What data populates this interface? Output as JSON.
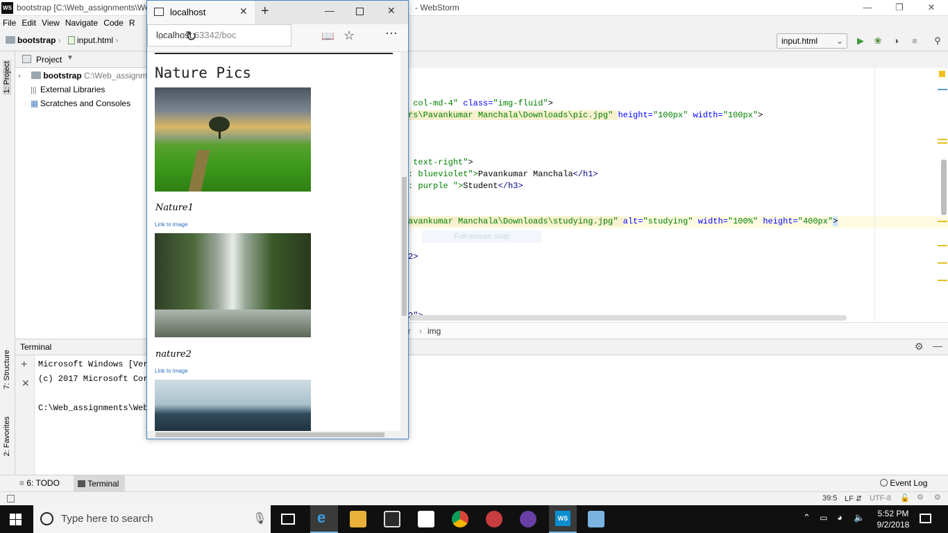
{
  "ide": {
    "title_left": "bootstrap [C:\\Web_assignments\\We",
    "title_right": "- WebStorm",
    "menu": [
      "File",
      "Edit",
      "View",
      "Navigate",
      "Code",
      "R"
    ],
    "breadcrumbs": [
      "bootstrap",
      "input.html"
    ],
    "run_config": "input.html",
    "project": {
      "header": "Project",
      "items": [
        {
          "name": "bootstrap",
          "path": "C:\\Web_assignm"
        },
        {
          "name": "External Libraries"
        },
        {
          "name": "Scratches and Consoles"
        }
      ]
    },
    "left_tools": [
      "1: Project",
      "7: Structure",
      "2: Favorites"
    ],
    "code_lines": [
      {
        "a": "col-md-4\" ",
        "b": "class=",
        "c": "\"img-fluid\"",
        "d": ">"
      },
      {
        "a": "rs\\Pavankumar Manchala\\Downloads\\pic.jpg\" ",
        "b": "height=",
        "c": "\"100px\" ",
        "b2": "width=",
        "c2": "\"100px\"",
        "d": ">"
      },
      {
        "a": "text-right\"",
        "d": ">"
      },
      {
        "a": ": blueviolet\">",
        "t": "Pavankumar Manchala",
        "d": "</h1>"
      },
      {
        "a": ": purple \">",
        "t": "Student",
        "d": "</h3>"
      },
      {
        "a": "avankumar Manchala\\Downloads\\studying.jpg\" ",
        "b": "alt=",
        "c": "\"studying\" ",
        "b2": "width=",
        "c2": "\"100%\" ",
        "b3": "height=",
        "c3": "\"400px\"",
        "d": ">"
      },
      {
        "a": "2>"
      },
      {
        "a": "2\">"
      }
    ],
    "snip_hint": "Full-screen Snip",
    "editor_breadcrumb": [
      "r",
      "img"
    ],
    "terminal": {
      "title": "Terminal",
      "lines": [
        "Microsoft Windows [Vers",
        "(c) 2017 Microsoft Corp",
        "",
        "C:\\Web_assignments\\Web_"
      ]
    },
    "bottom_tabs": [
      "6: TODO",
      "Terminal"
    ],
    "event_log": "Event Log",
    "status": {
      "position": "39:5",
      "line_sep": "LF",
      "encoding": "UTF-8"
    }
  },
  "browser": {
    "tab_title": "localhost",
    "address": "localhost",
    "address_rest": ":63342/boc",
    "heading": "Nature Pics",
    "items": [
      {
        "caption": "Nature1",
        "link": "Link to image"
      },
      {
        "caption": "nature2",
        "link": "Link to image"
      }
    ]
  },
  "taskbar": {
    "search_placeholder": "Type here to search",
    "time": "5:52 PM",
    "date": "9/2/2018"
  }
}
